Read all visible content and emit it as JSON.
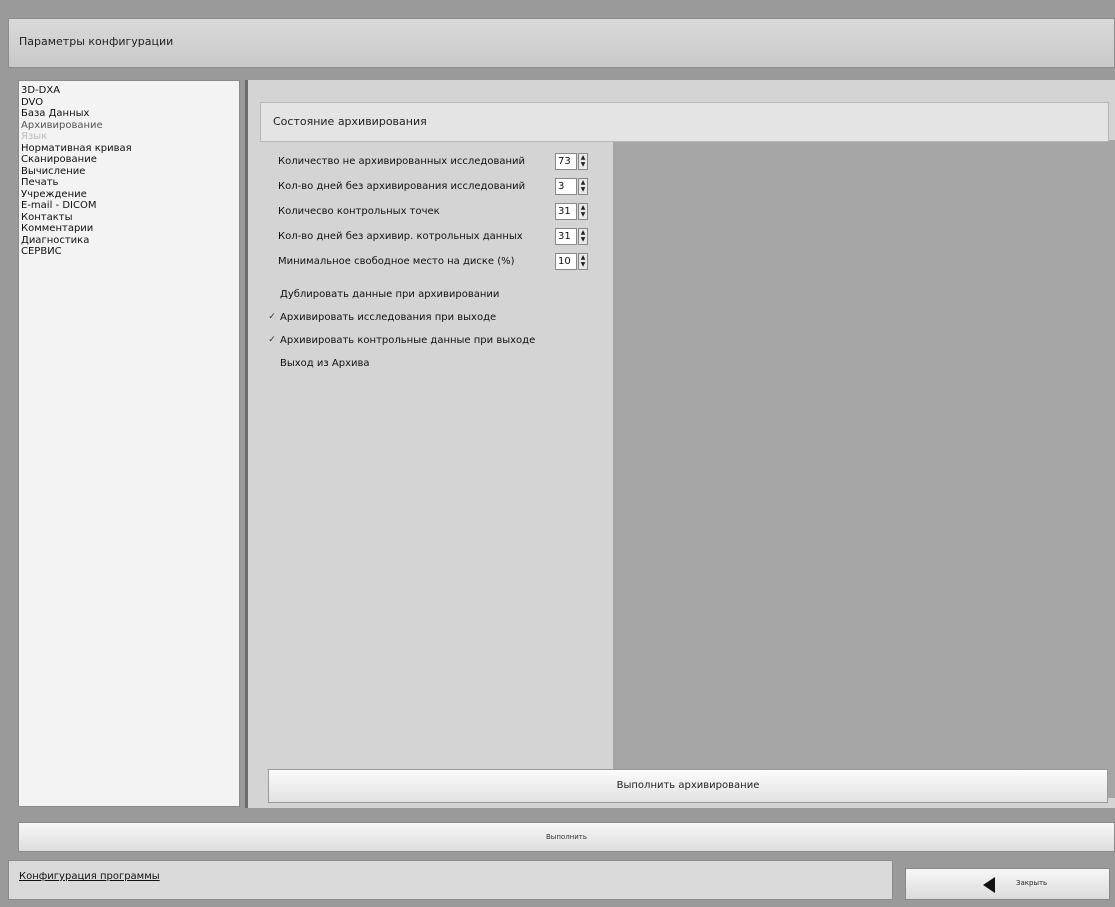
{
  "window": {
    "title": "Параметры конфигурации"
  },
  "sidebar": {
    "items": [
      {
        "label": "3D-DXA",
        "state": "normal"
      },
      {
        "label": "DVO",
        "state": "normal"
      },
      {
        "label": "База Данных",
        "state": "normal"
      },
      {
        "label": "Архивирование",
        "state": "selected"
      },
      {
        "label": "Язык",
        "state": "muted"
      },
      {
        "label": "Нормативная кривая",
        "state": "normal"
      },
      {
        "label": "Сканирование",
        "state": "normal"
      },
      {
        "label": "Вычисление",
        "state": "normal"
      },
      {
        "label": "Печать",
        "state": "normal"
      },
      {
        "label": "Учреждение",
        "state": "normal"
      },
      {
        "label": "E-mail - DICOM",
        "state": "normal"
      },
      {
        "label": "Контакты",
        "state": "normal"
      },
      {
        "label": "Комментарии",
        "state": "normal"
      },
      {
        "label": "Диагностика",
        "state": "normal"
      },
      {
        "label": "СЕРВИС",
        "state": "normal"
      }
    ]
  },
  "panel": {
    "header": "Состояние архивирования",
    "fields": [
      {
        "label": "Количество не архивированных исследований",
        "value": "73"
      },
      {
        "label": "Кол-во дней без архивирования исследований",
        "value": "3"
      },
      {
        "label": "Количесво контрольных точек",
        "value": "31"
      },
      {
        "label": "Кол-во дней без архивир. котрольных данных",
        "value": "31"
      },
      {
        "label": "Минимальное свободное место на диске (%)",
        "value": "10"
      }
    ],
    "checkboxes": [
      {
        "label": "Дублировать данные при архивировании",
        "checked": false
      },
      {
        "label": "Архивировать исследования при выходе",
        "checked": true
      },
      {
        "label": "Архивировать контрольные данные при выходе",
        "checked": true
      },
      {
        "label": "Выход из Архива",
        "checked": false
      }
    ],
    "archive_button": "Выполнить архивирование"
  },
  "apply_button": "Выполнить",
  "bottom": {
    "link": "Конфигурация программы",
    "close_button": "Закрыть"
  },
  "colors": {
    "background": "#9a9a9a",
    "panel": "#d4d4d4",
    "sidebar": "#f3f3f3",
    "preview": "#a5a5a5"
  }
}
